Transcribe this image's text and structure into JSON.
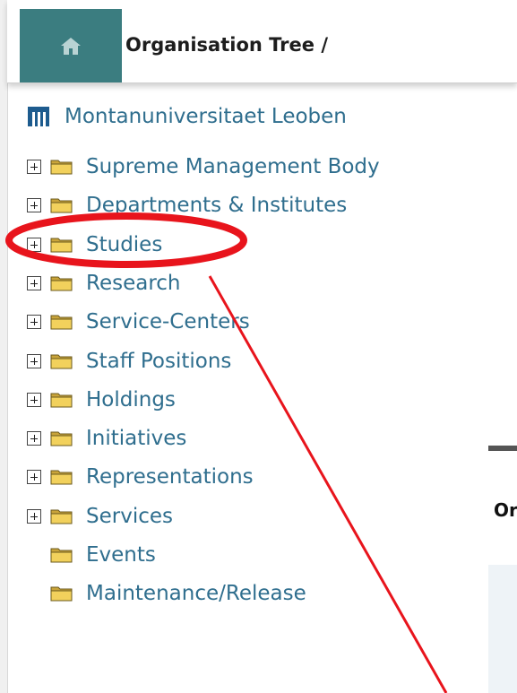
{
  "header": {
    "home_icon": "home-icon",
    "title": "Organisation Tree /"
  },
  "tree": {
    "root": {
      "label": "Montanuniversitaet Leoben",
      "logo": "university-logo-icon"
    },
    "nodes": [
      {
        "label": "Supreme Management Body",
        "expandable": true
      },
      {
        "label": "Departments & Institutes",
        "expandable": true
      },
      {
        "label": "Studies",
        "expandable": true
      },
      {
        "label": "Research",
        "expandable": true
      },
      {
        "label": "Service-Centers",
        "expandable": true
      },
      {
        "label": "Staff Positions",
        "expandable": true
      },
      {
        "label": "Holdings",
        "expandable": true
      },
      {
        "label": "Initiatives",
        "expandable": true
      },
      {
        "label": "Representations",
        "expandable": true
      },
      {
        "label": "Services",
        "expandable": true
      },
      {
        "label": "Events",
        "expandable": false
      },
      {
        "label": "Maintenance/Release",
        "expandable": false
      }
    ]
  },
  "side_panel": {
    "label": "Or"
  },
  "colors": {
    "accent": "#3b7d80",
    "link": "#2f6e8e",
    "annotation": "#e8141c",
    "folder": "#f2d15c"
  }
}
